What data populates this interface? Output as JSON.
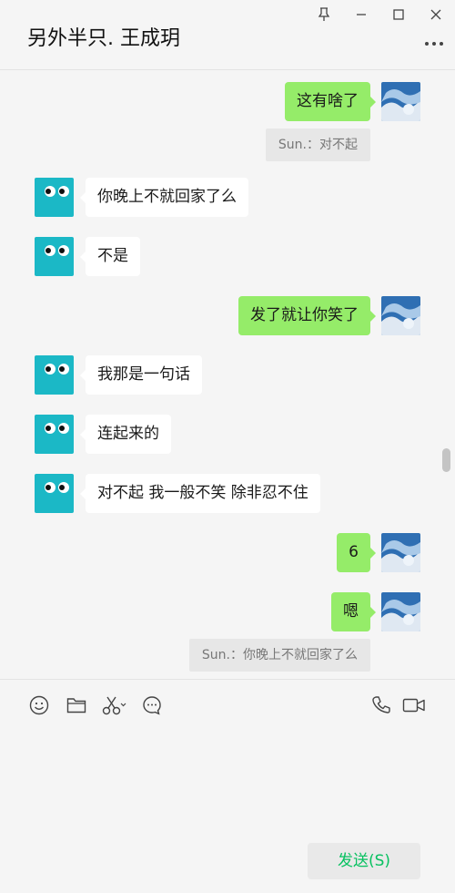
{
  "header": {
    "title": "另外半只. 王成玥"
  },
  "colors": {
    "outgoing_bubble": "#95ec69",
    "incoming_bubble": "#ffffff",
    "send_text": "#07c160",
    "incoming_avatar": "#1bb8c6"
  },
  "messages": [
    {
      "dir": "out",
      "text": "这有啥了"
    },
    {
      "dir": "quote",
      "text": "Sun.：对不起"
    },
    {
      "dir": "in",
      "text": "你晚上不就回家了么"
    },
    {
      "dir": "in",
      "text": "不是"
    },
    {
      "dir": "out",
      "text": "发了就让你笑了"
    },
    {
      "dir": "in",
      "text": "我那是一句话"
    },
    {
      "dir": "in",
      "text": "连起来的"
    },
    {
      "dir": "in",
      "text": "对不起 我一般不笑 除非忍不住"
    },
    {
      "dir": "out",
      "text": "6"
    },
    {
      "dir": "out",
      "text": "嗯"
    },
    {
      "dir": "quote",
      "text": "Sun.：你晚上不就回家了么"
    }
  ],
  "toolbar": {
    "left_icons": [
      "emoji-icon",
      "folder-icon",
      "scissors-icon",
      "chat-history-icon"
    ],
    "right_icons": [
      "phone-icon",
      "video-icon"
    ]
  },
  "composer": {
    "send_label": "发送(S)"
  }
}
